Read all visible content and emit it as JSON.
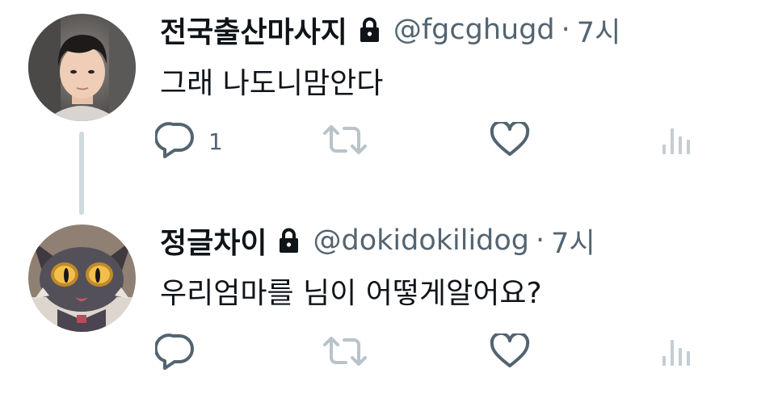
{
  "tweets": [
    {
      "display_name": "전국출산마사지",
      "handle": "@fgcghugd",
      "separator": "·",
      "time": "7시",
      "text": "그래 나도니맘안다",
      "reply_count": "1",
      "protected": true,
      "avatar": "photo of a young man in a car"
    },
    {
      "display_name": "정글차이",
      "handle": "@dokidokilidog",
      "separator": "·",
      "time": "7시",
      "text": "우리엄마를 님이 어떻게알어요?",
      "reply_count": "",
      "protected": true,
      "avatar": "cartoon cat character with large yellow eyes"
    }
  ],
  "icons": {
    "reply": "reply-icon",
    "retweet": "retweet-icon",
    "like": "heart-icon",
    "views": "views-icon",
    "lock": "lock-icon"
  },
  "colors": {
    "text_primary": "#0f1419",
    "text_secondary": "#536471",
    "icon_faded": "#b9c3ca",
    "thread_line": "#cfd9de"
  }
}
